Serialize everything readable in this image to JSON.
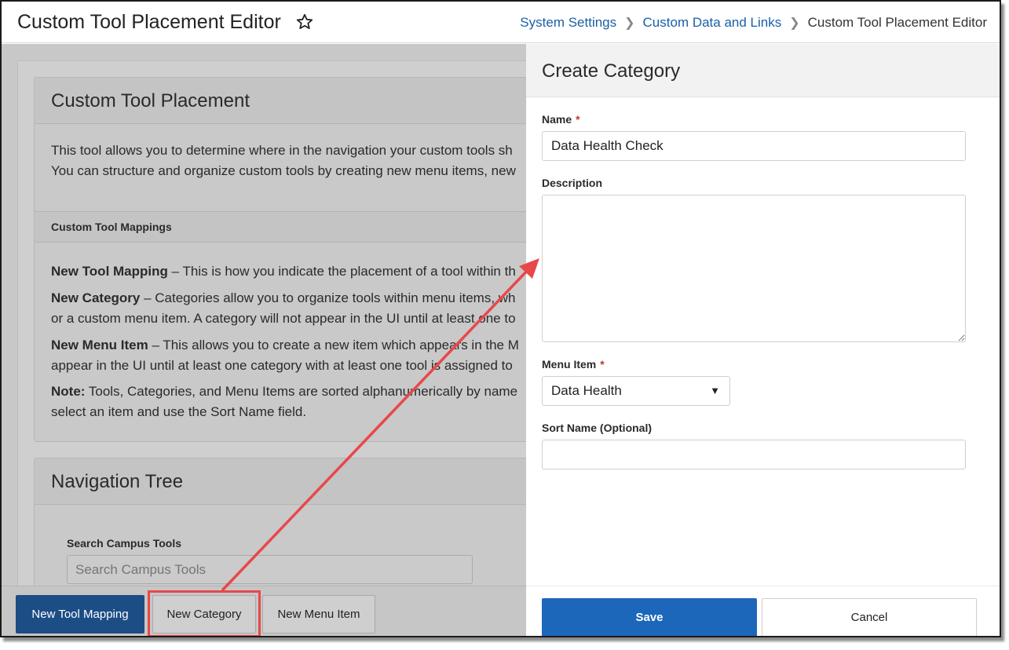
{
  "header": {
    "title": "Custom Tool Placement Editor",
    "breadcrumbs": [
      {
        "label": "System Settings"
      },
      {
        "label": "Custom Data and Links"
      },
      {
        "label": "Custom Tool Placement Editor"
      }
    ]
  },
  "placement_panel": {
    "title": "Custom Tool Placement",
    "intro_line1": "This tool allows you to determine where in the navigation your custom tools sh",
    "intro_line2": "You can structure and organize custom tools by creating new menu items, new",
    "mappings_heading": "Custom Tool Mappings",
    "items": [
      {
        "term": "New Tool Mapping",
        "text": " – This is how you indicate the placement of a tool within th"
      },
      {
        "term": "New Category",
        "text": " – Categories allow you to organize tools within menu items, wh",
        "text2": "or a custom menu item. A category will not appear in the UI until at least one to"
      },
      {
        "term": "New Menu Item",
        "text": " – This allows you to create a new item which appears in the M",
        "text2": "appear in the UI until at least one category with at least one tool is assigned to"
      },
      {
        "term": "Note:",
        "text": " Tools, Categories, and Menu Items are sorted alphanumerically by name",
        "text2": "select an item and use the Sort Name field."
      }
    ]
  },
  "navigation_panel": {
    "title": "Navigation Tree",
    "search_label": "Search Campus Tools",
    "search_placeholder": "Search Campus Tools"
  },
  "bottom_toolbar": {
    "new_tool_mapping": "New Tool Mapping",
    "new_category": "New Category",
    "new_menu_item": "New Menu Item"
  },
  "create_category": {
    "title": "Create Category",
    "name_label": "Name",
    "name_value": "Data Health Check",
    "description_label": "Description",
    "description_value": "",
    "menu_item_label": "Menu Item",
    "menu_item_value": "Data Health",
    "sort_name_label": "Sort Name (Optional)",
    "sort_name_value": "",
    "required_mark": "*",
    "save": "Save",
    "cancel": "Cancel"
  },
  "colors": {
    "primary": "#1d67ba",
    "link": "#1b5fa6",
    "annotation": "#e8484a"
  },
  "icons": [
    "star-icon",
    "chevron-right-icon",
    "caret-down-icon"
  ]
}
